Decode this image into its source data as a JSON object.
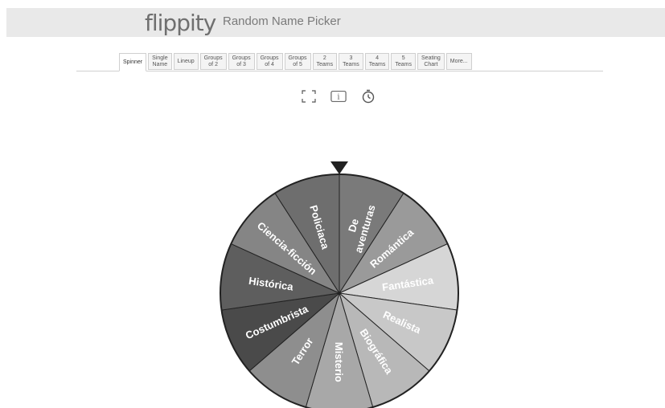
{
  "app": {
    "logo": "flippity",
    "title": "Random Name Picker"
  },
  "tabs": [
    {
      "label": "Spinner",
      "active": true
    },
    {
      "label": "Single\nName"
    },
    {
      "label": "Lineup"
    },
    {
      "label": "Groups\nof 2"
    },
    {
      "label": "Groups\nof 3"
    },
    {
      "label": "Groups\nof 4"
    },
    {
      "label": "Groups\nof 5"
    },
    {
      "label": "2\nTeams"
    },
    {
      "label": "3\nTeams"
    },
    {
      "label": "4\nTeams"
    },
    {
      "label": "5\nTeams"
    },
    {
      "label": "Seating\nChart"
    },
    {
      "label": "More..."
    }
  ],
  "toolbar": {
    "fullscreen_icon": "fullscreen-icon",
    "info_icon": "info-icon",
    "timer_icon": "timer-icon",
    "info_glyph": "i"
  },
  "wheel": {
    "segments": [
      {
        "label": "De\naventuras",
        "color": "#7a7a7a",
        "text_color": "#ffffff"
      },
      {
        "label": "Romántica",
        "color": "#9a9a9a",
        "text_color": "#ffffff"
      },
      {
        "label": "Fantástica",
        "color": "#d6d6d6",
        "text_color": "#ffffff"
      },
      {
        "label": "Realista",
        "color": "#c8c8c8",
        "text_color": "#ffffff"
      },
      {
        "label": "Biográfica",
        "color": "#b8b8b8",
        "text_color": "#ffffff"
      },
      {
        "label": "Misterio",
        "color": "#a8a8a8",
        "text_color": "#ffffff"
      },
      {
        "label": "Terror",
        "color": "#8e8e8e",
        "text_color": "#ffffff"
      },
      {
        "label": "Costumbrista",
        "color": "#4a4a4a",
        "text_color": "#ffffff"
      },
      {
        "label": "Histórica",
        "color": "#5e5e5e",
        "text_color": "#ffffff"
      },
      {
        "label": "Ciencia-ficción",
        "color": "#858585",
        "text_color": "#ffffff"
      },
      {
        "label": "Policiaca",
        "color": "#6e6e6e",
        "text_color": "#ffffff"
      }
    ]
  }
}
